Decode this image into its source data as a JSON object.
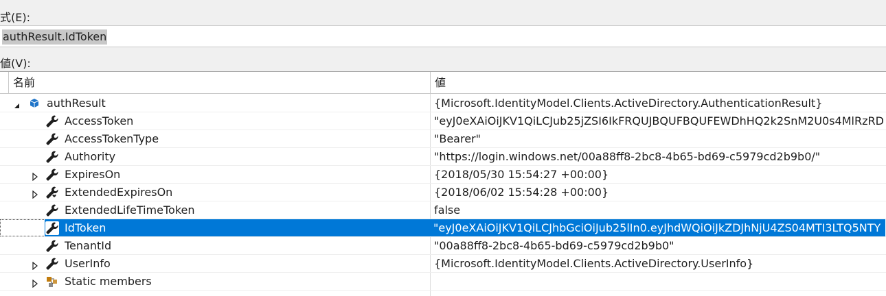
{
  "expression": {
    "label": "式(E):",
    "value": "authResult.IdToken"
  },
  "value_section": {
    "label": "値(V):"
  },
  "grid": {
    "columns": {
      "name": "名前",
      "value": "値"
    },
    "rows": [
      {
        "name": "authResult",
        "value": "{Microsoft.IdentityModel.Clients.ActiveDirectory.AuthenticationResult}",
        "icon": "object-cube-icon",
        "expander": "expanded"
      },
      {
        "name": "AccessToken",
        "value": "\"eyJ0eXAiOiJKV1QiLCJub25jZSI6IkFRQUJBQUFBQUFEWDhHQ2k2SnM2U0s4MlRzRD",
        "icon": "property-wrench-icon"
      },
      {
        "name": "AccessTokenType",
        "value": "\"Bearer\"",
        "icon": "property-wrench-icon"
      },
      {
        "name": "Authority",
        "value": "\"https://login.windows.net/00a88ff8-2bc8-4b65-bd69-c5979cd2b9b0/\"",
        "icon": "property-wrench-icon"
      },
      {
        "name": "ExpiresOn",
        "value": "{2018/05/30 15:54:27 +00:00}",
        "icon": "property-wrench-icon",
        "expander": "collapsed"
      },
      {
        "name": "ExtendedExpiresOn",
        "value": "{2018/06/02 15:54:28 +00:00}",
        "icon": "property-wrench-heart-icon",
        "expander": "collapsed"
      },
      {
        "name": "ExtendedLifeTimeToken",
        "value": "false",
        "icon": "property-wrench-icon"
      },
      {
        "name": "IdToken",
        "value": "\"eyJ0eXAiOiJKV1QiLCJhbGciOiJub25lIn0.eyJhdWQiOiJkZDJhNjU4ZS04MTI3LTQ5NTY",
        "icon": "property-wrench-icon",
        "selected": true
      },
      {
        "name": "TenantId",
        "value": "\"00a88ff8-2bc8-4b65-bd69-c5979cd2b9b0\"",
        "icon": "property-wrench-icon"
      },
      {
        "name": "UserInfo",
        "value": "{Microsoft.IdentityModel.Clients.ActiveDirectory.UserInfo}",
        "icon": "property-wrench-icon",
        "expander": "collapsed"
      },
      {
        "name": "Static members",
        "value": "",
        "icon": "static-members-icon",
        "expander": "collapsed"
      }
    ]
  },
  "colors": {
    "selection": "#0078d7",
    "object_icon": "#1e74c8",
    "static_icon": "#c27d0e"
  }
}
